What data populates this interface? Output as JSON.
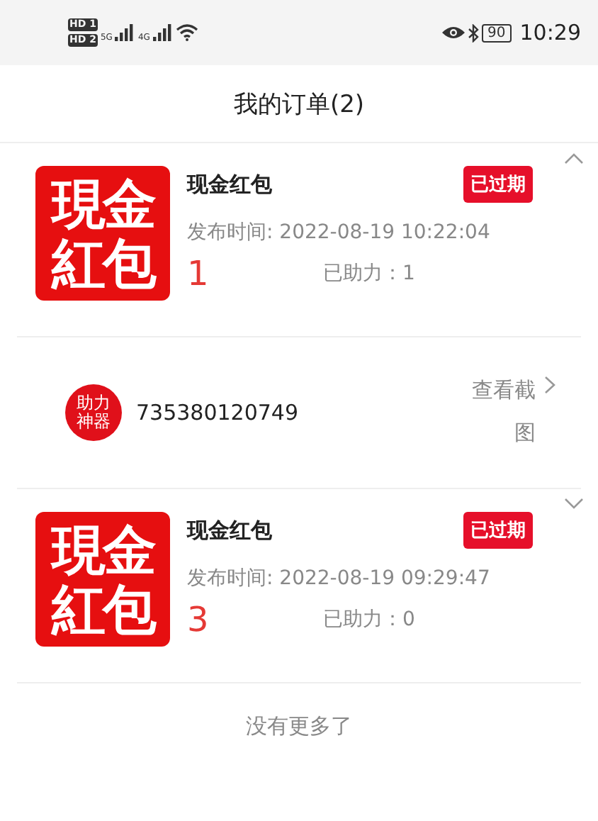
{
  "status_bar": {
    "sims": [
      {
        "badge": "HD",
        "slot": "1",
        "network": "5G"
      },
      {
        "badge": "HD",
        "slot": "2",
        "network": "4G"
      }
    ],
    "battery": "90",
    "time": "10:29"
  },
  "header": {
    "title": "我的订单(2)"
  },
  "orders": [
    {
      "logo": "現金紅包",
      "title": "现金红包",
      "status": "已过期",
      "time_label": "发布时间:",
      "time": "2022-08-19 10:22:04",
      "count": "1",
      "helped": "已助力：1",
      "expanded": true,
      "helpers": [
        {
          "avatar": "助力神器",
          "id": "735380120749",
          "action": "查看截图"
        }
      ]
    },
    {
      "logo": "現金紅包",
      "title": "现金红包",
      "status": "已过期",
      "time_label": "发布时间:",
      "time": "2022-08-19 09:29:47",
      "count": "3",
      "helped": "已助力：0",
      "expanded": false
    }
  ],
  "footer": "没有更多了"
}
